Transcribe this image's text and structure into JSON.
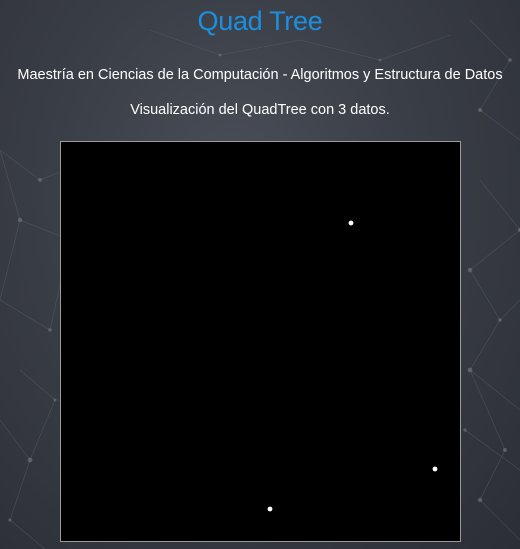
{
  "header": {
    "title": "Quad Tree",
    "subtitle": "Maestría en Ciencias de la Computación - Algoritmos y Estructura de Datos",
    "caption": "Visualización del QuadTree con 3 datos."
  },
  "colors": {
    "title": "#1b8fe0",
    "text": "#ffffff",
    "canvas_background": "#000000",
    "point": "#ffffff"
  },
  "quadtree": {
    "point_count": 3
  }
}
